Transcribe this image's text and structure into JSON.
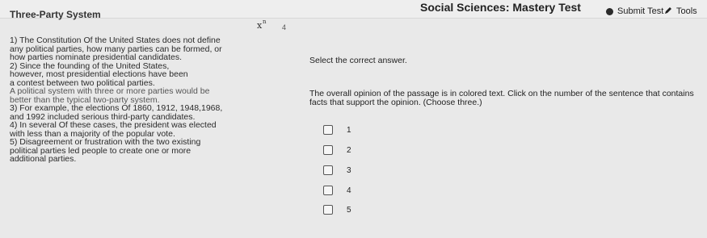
{
  "header": {
    "app_title": "Three-Party System",
    "test_title": "Social Sciences: Mastery Test",
    "submit_label": "Submit Test",
    "tools_label": "Tools"
  },
  "question": {
    "number": "4",
    "passage_lines": [
      "1) The Constitution Of the United States does not define",
      "any political parties, how many parties can be formed, or",
      "how parties nominate presidential candidates.",
      "2) Since the founding of the United States,",
      "however, most presidential elections have been",
      "a contest between two political parties.",
      "A political system with three or more parties would be",
      "better than the typical two-party system.",
      "3) For example, the elections Of 1860, 1912, 1948,1968,",
      "and 1992 included serious third-party candidates.",
      "4) In several Of these cases, the president was elected",
      "with less than a majority of the popular vote.",
      "5) Disagreement or frustration with the two existing",
      "political parties led people to create one or more",
      "additional parties."
    ],
    "instruction": "Select the correct answer.",
    "prompt": "The overall opinion of the passage is in colored text. Click on the number of the sentence that contains facts that support the opinion. (Choose three.)",
    "options": [
      "1",
      "2",
      "3",
      "4",
      "5"
    ]
  }
}
